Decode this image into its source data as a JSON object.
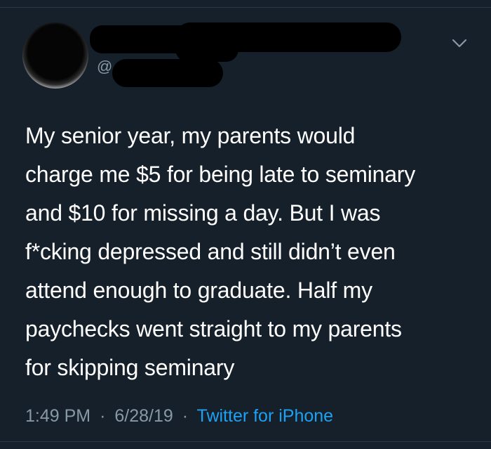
{
  "tweet": {
    "handle_prefix": "@",
    "text_lines": [
      "My senior year, my parents would",
      "charge me $5 for being late to seminary",
      "and $10 for missing a day. But I was",
      "f*cking depressed and still didn’t even",
      "attend enough to graduate. Half my",
      "paychecks went straight to my parents",
      "for skipping seminary"
    ],
    "time": "1:49 PM",
    "separator": "·",
    "date": "6/28/19",
    "source": "Twitter for iPhone"
  },
  "icons": {
    "menu": "chevron-down-icon"
  },
  "colors": {
    "background": "#16202b",
    "text": "#ffffff",
    "muted": "#8899a6",
    "link": "#1da1f2"
  }
}
